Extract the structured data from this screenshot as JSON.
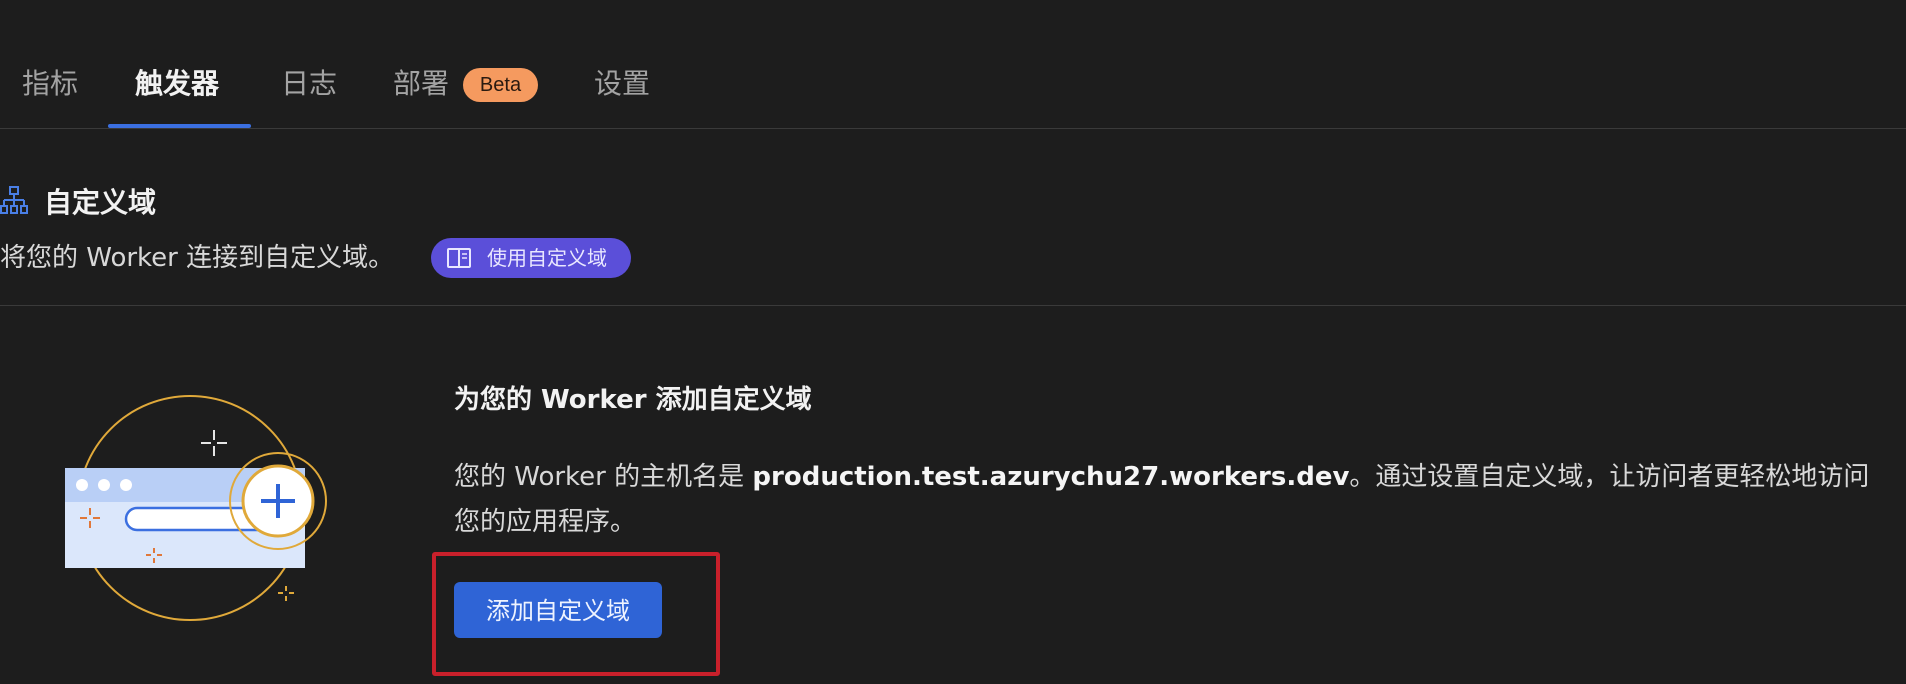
{
  "tabs": [
    {
      "label": "指标",
      "active": false
    },
    {
      "label": "触发器",
      "active": true
    },
    {
      "label": "日志",
      "active": false
    },
    {
      "label": "部署",
      "active": false,
      "badge": "Beta"
    },
    {
      "label": "设置",
      "active": false
    }
  ],
  "section": {
    "icon": "sitemap-icon",
    "title": "自定义域",
    "description": "将您的 Worker 连接到自定义域。",
    "doc_link": {
      "icon": "book-icon",
      "label": "使用自定义域"
    }
  },
  "content": {
    "illustration": "browser-add-domain-illustration",
    "title": "为您的 Worker 添加自定义域",
    "body_prefix": "您的 Worker 的主机名是 ",
    "hostname": "production.test.azurychu27.workers.dev",
    "body_suffix": "。通过设置自定义域，让访问者更轻松地访问您的应用程序。",
    "button_label": "添加自定义域"
  },
  "colors": {
    "background": "#1d1d1d",
    "accent": "#3b6fe0",
    "button": "#2f64d6",
    "beta_badge": "#f59a5f",
    "doc_pill": "#5b4fd9",
    "highlight": "#c8202b"
  }
}
